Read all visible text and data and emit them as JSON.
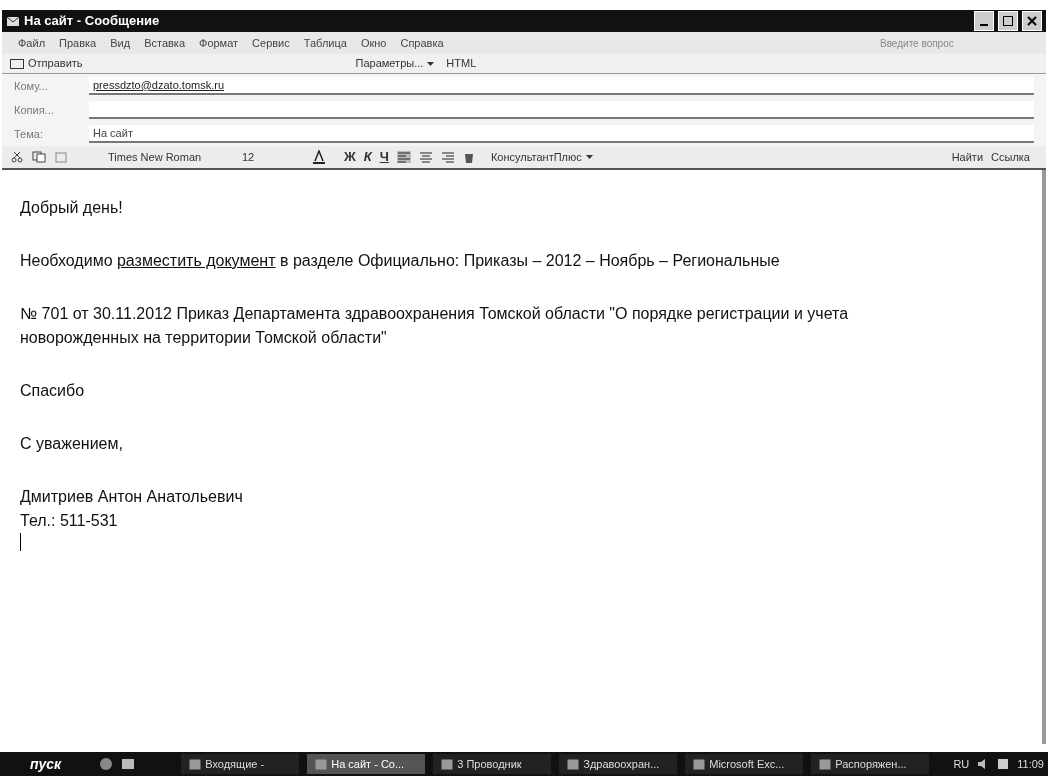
{
  "window": {
    "title": "На сайт - Сообщение"
  },
  "menu": [
    "Файл",
    "Правка",
    "Вид",
    "Вставка",
    "Формат",
    "Сервис",
    "Таблица",
    "Окно",
    "Справка"
  ],
  "help_box": {
    "placeholder": "Введите вопрос"
  },
  "toolbar": {
    "send": "Отправить",
    "options": "Параметры...",
    "format": "HTML"
  },
  "fields": [
    {
      "label": "Кому...",
      "value": "pressdzto@dzato.tomsk.ru"
    },
    {
      "label": "Копия..."
    },
    {
      "label": "Тема:",
      "value": "На сайт"
    }
  ],
  "format_bar": {
    "font": "Times New Roman",
    "size": "12",
    "bold": "Ж",
    "italic": "К",
    "underline": "Ч",
    "addin": "КонсультантПлюс",
    "find": "Найти",
    "link": "Ссылка"
  },
  "body": [
    {
      "parts": [
        {
          "text": "Добрый день!"
        }
      ]
    },
    {
      "parts": [
        {
          "text": "Необходимо "
        },
        {
          "text": "разместить документ",
          "kind": "link"
        },
        {
          "text": "  в разделе Официально:  Приказы – 2012 – Ноябрь – Региональные"
        }
      ]
    },
    {
      "parts": [
        {
          "text": "№ 701 от 30.11.2012 Приказ Департамента здравоохранения Томской области \"О порядке регистрации и учета новорожденных на территории Томской области\""
        }
      ]
    },
    {
      "parts": [
        {
          "text": "Спасибо"
        }
      ]
    },
    {
      "parts": [
        {
          "text": "С уважением,"
        }
      ]
    },
    {
      "lines": [
        "Дмитриев Антон Анатольевич",
        "Тел.: 511-531"
      ]
    }
  ],
  "taskbar": {
    "start": "пуск",
    "tasks": [
      {
        "label": "Входящие -",
        "selected": false
      },
      {
        "label": "На сайт - Со...",
        "selected": true
      },
      {
        "label": "3 Проводник",
        "selected": false
      },
      {
        "label": "Здравоохран...",
        "selected": false
      },
      {
        "label": "Microsoft Exc...",
        "selected": false
      },
      {
        "label": "Распоряжен...",
        "selected": false
      }
    ],
    "lang": "RU",
    "clock": "11:09"
  }
}
